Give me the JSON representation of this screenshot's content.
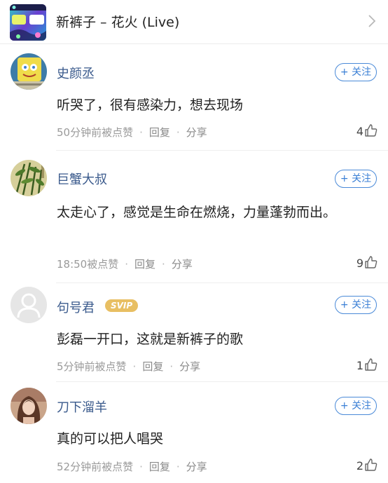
{
  "header": {
    "title": "新裤子 – 花火 (Live)"
  },
  "comments": [
    {
      "username": "史颜丞",
      "badge": "",
      "follow_label": "+ 关注",
      "text": "听哭了，很有感染力，想去现场",
      "time": "50分钟前被点赞",
      "reply_label": "回复",
      "share_label": "分享",
      "likes": "4"
    },
    {
      "username": "巨蟹大叔",
      "badge": "",
      "follow_label": "+ 关注",
      "text": "太走心了，感觉是生命在燃烧，力量蓬勃而出。",
      "time": "18:50被点赞",
      "reply_label": "回复",
      "share_label": "分享",
      "likes": "9"
    },
    {
      "username": "句号君",
      "badge": "SVIP",
      "follow_label": "+ 关注",
      "text": "彭磊一开口，这就是新裤子的歌",
      "time": "5分钟前被点赞",
      "reply_label": "回复",
      "share_label": "分享",
      "likes": "1"
    },
    {
      "username": "刀下溜羊",
      "badge": "",
      "follow_label": "+ 关注",
      "text": "真的可以把人唱哭",
      "time": "52分钟前被点赞",
      "reply_label": "回复",
      "share_label": "分享",
      "likes": "2"
    }
  ],
  "colors": {
    "username": "#3a5a8c",
    "follow": "#3a7fd5",
    "svip": "#e8bf63",
    "meta": "#9a9a9a"
  }
}
